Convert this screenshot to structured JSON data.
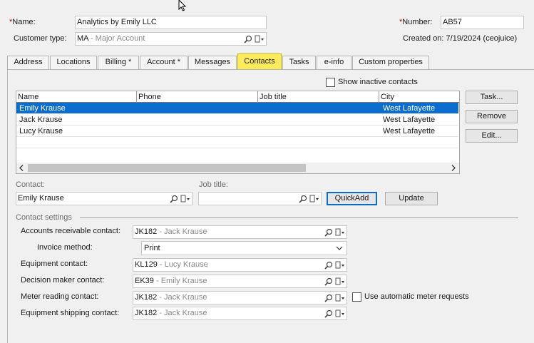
{
  "header": {
    "name_label": "Name:",
    "name_required_mark": "*",
    "name_value": "Analytics by Emily LLC",
    "customer_type_label": "Customer type:",
    "customer_type_code": "MA",
    "customer_type_desc": " - Major Account",
    "number_label": "Number:",
    "number_required_mark": "*",
    "number_value": "AB57",
    "created_on": "Created on: 7/19/2024 (ceojuice)"
  },
  "tabs": [
    {
      "label": "Address"
    },
    {
      "label": "Locations"
    },
    {
      "label": "Billing *"
    },
    {
      "label": "Account *"
    },
    {
      "label": "Messages"
    },
    {
      "label": "Contacts",
      "active": true
    },
    {
      "label": "Tasks"
    },
    {
      "label": "e-info"
    },
    {
      "label": "Custom properties"
    }
  ],
  "contacts": {
    "show_inactive_label": "Show inactive contacts",
    "show_inactive_checked": false,
    "columns": [
      "Name",
      "Phone",
      "Job title",
      "City"
    ],
    "rows": [
      {
        "name": "Emily Krause",
        "phone": "",
        "job_title": "",
        "city": "West Lafayette",
        "selected": true
      },
      {
        "name": "Jack Krause",
        "phone": "",
        "job_title": "",
        "city": "West Lafayette",
        "selected": false
      },
      {
        "name": "Lucy Krause",
        "phone": "",
        "job_title": "",
        "city": "West Lafayette",
        "selected": false
      }
    ],
    "side_buttons": {
      "task": "Task...",
      "remove": "Remove",
      "edit": "Edit..."
    },
    "contact_label": "Contact:",
    "contact_value": "Emily Krause",
    "job_title_label": "Job title:",
    "job_title_value": "",
    "quickadd_label": "QuickAdd",
    "update_label": "Update"
  },
  "settings": {
    "section_label": "Contact settings",
    "accounts_receivable": {
      "label": "Accounts receivable contact:",
      "code": "JK182",
      "desc": " - Jack Krause"
    },
    "invoice_method": {
      "label": "Invoice method:",
      "value": "Print"
    },
    "equipment": {
      "label": "Equipment contact:",
      "code": "KL129",
      "desc": " - Lucy Krause"
    },
    "decision_maker": {
      "label": "Decision maker contact:",
      "code": "EK39",
      "desc": " - Emily Krause"
    },
    "meter_reading": {
      "label": "Meter reading contact:",
      "code": "JK182",
      "desc": " - Jack Krause"
    },
    "auto_meter_label": "Use automatic meter requests",
    "auto_meter_checked": false,
    "equipment_shipping": {
      "label": "Equipment shipping contact:",
      "code": "JK182",
      "desc": " - Jack Krause"
    }
  },
  "colors": {
    "active_tab": "#fcec5a",
    "selection": "#0c6dce",
    "required": "#c00000"
  }
}
